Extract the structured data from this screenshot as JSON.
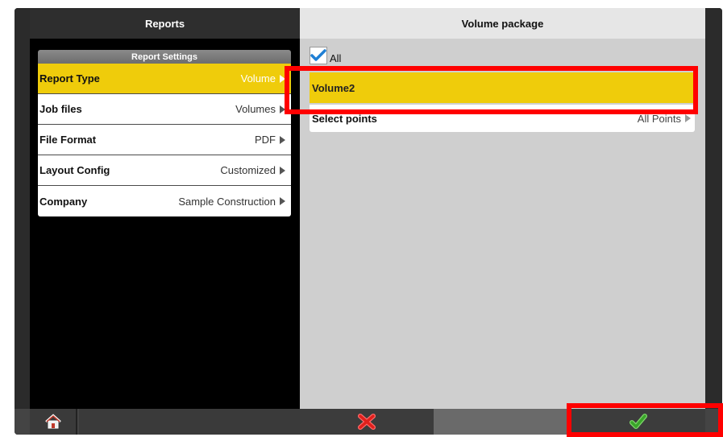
{
  "left_panel": {
    "title": "Reports",
    "settings_title": "Report Settings",
    "rows": [
      {
        "label": "Report Type",
        "value": "Volume",
        "active": true
      },
      {
        "label": "Job files",
        "value": "Volumes",
        "active": false
      },
      {
        "label": "File Format",
        "value": "PDF",
        "active": false
      },
      {
        "label": "Layout Config",
        "value": "Customized",
        "active": false
      },
      {
        "label": "Company",
        "value": "Sample Construction",
        "active": false
      }
    ]
  },
  "right_panel": {
    "title": "Volume package",
    "all_label": "All",
    "all_checked": true,
    "package_item": "Volume2",
    "select_points": {
      "label": "Select points",
      "value": "All Points"
    }
  },
  "bottom_bar": {
    "home": "home-icon",
    "cancel": "cancel-x-icon",
    "confirm": "checkmark-icon"
  },
  "colors": {
    "accent_yellow": "#efcc0b",
    "highlight_red": "#ff0000",
    "cancel_red": "#e0201c",
    "confirm_green": "#3aa52a"
  }
}
